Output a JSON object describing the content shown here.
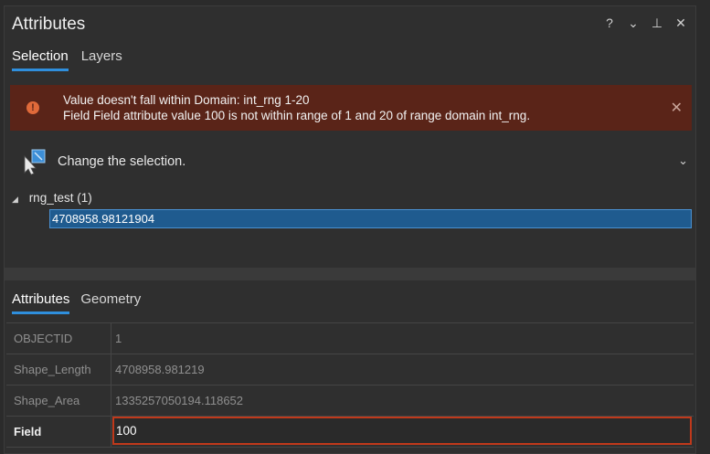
{
  "window": {
    "title": "Attributes",
    "icons": [
      "help-icon",
      "dropdown-icon",
      "pin-icon",
      "close-icon"
    ],
    "help_glyph": "?",
    "dropdown_glyph": "⌄",
    "pin_glyph": "⊥",
    "close_glyph": "✕"
  },
  "top_tabs": [
    {
      "label": "Selection",
      "active": true
    },
    {
      "label": "Layers",
      "active": false
    }
  ],
  "error": {
    "line1": "Value doesn't fall within Domain: int_rng 1-20",
    "line2": "Field Field attribute value 100 is not within range of 1 and 20 of range domain int_rng.",
    "icon_glyph": "!",
    "close_glyph": "✕",
    "color": "#5a2418"
  },
  "change_selection": {
    "label": "Change the selection.",
    "chevron_glyph": "⌄"
  },
  "tree": {
    "arrow_glyph": "◢",
    "node_label": "rng_test (1)",
    "selected_item": "4708958.98121904"
  },
  "bottom_tabs": [
    {
      "label": "Attributes",
      "active": true
    },
    {
      "label": "Geometry",
      "active": false
    }
  ],
  "attributes": [
    {
      "name": "OBJECTID",
      "value": "1"
    },
    {
      "name": "Shape_Length",
      "value": "4708958.981219"
    },
    {
      "name": "Shape_Area",
      "value": "1335257050194.118652"
    },
    {
      "name": "Field",
      "value": "100"
    }
  ],
  "colors": {
    "accent": "#2f8fdd",
    "error_border": "#c0391b",
    "selection": "#1f5b8f"
  }
}
